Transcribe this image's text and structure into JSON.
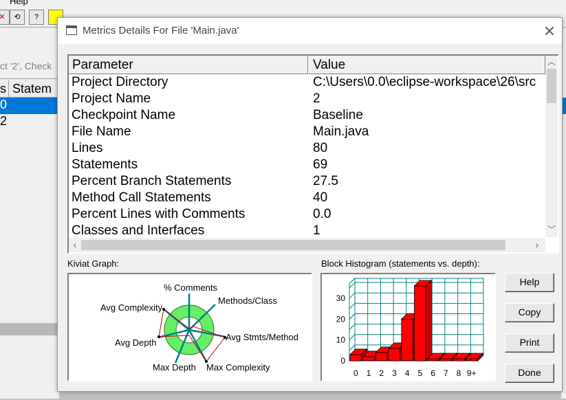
{
  "background": {
    "menu_help": "Help",
    "tab_text": "ct '2', Check",
    "header_col1": "s",
    "header_col2": "Statem",
    "row1": "0",
    "row2": "2",
    "selection_color": "#0078d7"
  },
  "dialog": {
    "title": "Metrics Details For File 'Main.java'",
    "close_icon": "close-icon",
    "table": {
      "headers": [
        "Parameter",
        "Value"
      ],
      "rows": [
        [
          "Project Directory",
          "C:\\Users\\0.0\\eclipse-workspace\\26\\src"
        ],
        [
          "Project Name",
          "2"
        ],
        [
          "Checkpoint Name",
          "Baseline"
        ],
        [
          "File Name",
          "Main.java"
        ],
        [
          "Lines",
          "80"
        ],
        [
          "Statements",
          "69"
        ],
        [
          "Percent Branch Statements",
          "27.5"
        ],
        [
          "Method Call Statements",
          "40"
        ],
        [
          "Percent Lines with Comments",
          "0.0"
        ],
        [
          "Classes and Interfaces",
          "1"
        ]
      ]
    },
    "kiviat": {
      "label": "Kiviat Graph:",
      "axes": [
        "% Comments",
        "Methods/Class",
        "Avg Stmts/Method",
        "Max Complexity",
        "Max Depth",
        "Avg Depth",
        "Avg Complexity"
      ],
      "ring_color": "#66ee66",
      "axis_color": "#008080",
      "polygon_color": "#cc0000"
    },
    "histogram": {
      "label": "Block Histogram (statements vs. depth):",
      "bar_color": "#ff0000",
      "grid_color": "#008080"
    },
    "buttons": {
      "help": "Help",
      "copy": "Copy",
      "print": "Print",
      "done": "Done"
    }
  },
  "chart_data": {
    "type": "bar",
    "title": "Block Histogram (statements vs. depth):",
    "categories": [
      "0",
      "1",
      "2",
      "3",
      "4",
      "5",
      "6",
      "7",
      "8",
      "9+"
    ],
    "values": [
      3,
      2,
      4,
      6,
      20,
      36,
      1,
      1,
      1,
      1
    ],
    "yticks": [
      "0",
      "10",
      "20",
      "30"
    ],
    "ylim": [
      0,
      37
    ],
    "grid": true
  }
}
